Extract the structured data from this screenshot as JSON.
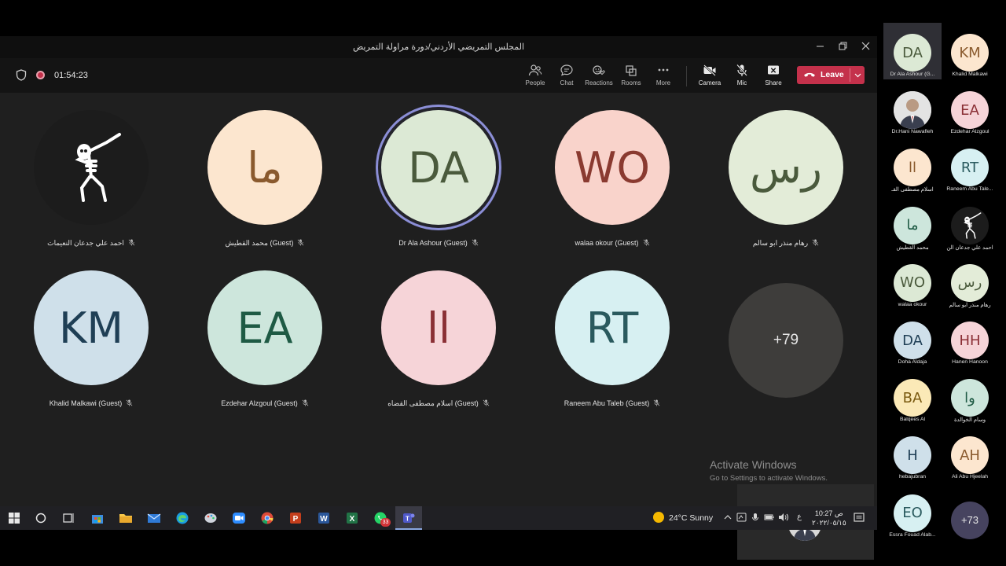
{
  "window": {
    "title": "المجلس التمريضي الأردني/دورة مراولة التمريض",
    "minimize_icon": "minimize-icon",
    "maximize_icon": "restore-icon",
    "close_icon": "close-icon"
  },
  "meeting": {
    "timer": "01:54:23",
    "toolbar": [
      {
        "id": "people",
        "label": "People",
        "icon": "people-icon"
      },
      {
        "id": "chat",
        "label": "Chat",
        "icon": "chat-icon"
      },
      {
        "id": "reactions",
        "label": "Reactions",
        "icon": "reactions-icon"
      },
      {
        "id": "rooms",
        "label": "Rooms",
        "icon": "rooms-icon"
      },
      {
        "id": "more",
        "label": "More",
        "icon": "more-icon"
      },
      {
        "id": "camera",
        "label": "Camera",
        "icon": "camera-off-icon"
      },
      {
        "id": "mic",
        "label": "Mic",
        "icon": "mic-off-icon"
      },
      {
        "id": "share",
        "label": "Share",
        "icon": "share-icon"
      }
    ],
    "leave_label": "Leave",
    "leave_color": "#c4314b"
  },
  "gallery": [
    {
      "initials": "",
      "name": "احمد علي جدعان النعيمات",
      "bg": "#1c1c1c",
      "fg": "#ffffff",
      "image": "dancing-skeleton"
    },
    {
      "initials": "ما",
      "name": "محمد القطيش (Guest)",
      "bg": "#fce6cf",
      "fg": "#8a5a2e"
    },
    {
      "initials": "DA",
      "name": "Dr Ala Ashour (Guest)",
      "bg": "#dce9d5",
      "fg": "#4a5a3c",
      "speaking": true
    },
    {
      "initials": "WO",
      "name": "walaa okour (Guest)",
      "bg": "#f9d3cb",
      "fg": "#8a3a30"
    },
    {
      "initials": "رس",
      "name": "رهام منذر ابو سالم",
      "bg": "#e3ecd8",
      "fg": "#4a5a3c"
    },
    {
      "initials": "KM",
      "name": "Khalid Malkawi (Guest)",
      "bg": "#cfe0ea",
      "fg": "#1f3f55"
    },
    {
      "initials": "EA",
      "name": "Ezdehar Alzgoul (Guest)",
      "bg": "#cde6dc",
      "fg": "#1e5a44"
    },
    {
      "initials": "اا",
      "name": "اسلام مصطفى القضاه (Guest)",
      "bg": "#f6d4d8",
      "fg": "#8a2f35"
    },
    {
      "initials": "RT",
      "name": "Raneem Abu Taleb (Guest)",
      "bg": "#d7f0f2",
      "fg": "#2a5a5e"
    }
  ],
  "overflow_count": "+79",
  "watermark": {
    "line1": "Activate Windows",
    "line2": "Go to Settings to activate Windows."
  },
  "sidebar": [
    {
      "initials": "DA",
      "name": "Dr Ala Ashour (G...",
      "bg": "#dce9d5",
      "fg": "#4a5a3c",
      "selected": true
    },
    {
      "initials": "KM",
      "name": "Khalid Malkawi",
      "bg": "#fce6cf",
      "fg": "#8a5a2e"
    },
    {
      "initials": "",
      "name": "Dr.Hani Nawafleh",
      "bg": "#e8e8e8",
      "fg": "#333333",
      "image": "photo"
    },
    {
      "initials": "EA",
      "name": "Ezdehar Alzgoul",
      "bg": "#f6d4d8",
      "fg": "#8a2f35"
    },
    {
      "initials": "اا",
      "name": "اسلام مصطفى القـ",
      "bg": "#fce6cf",
      "fg": "#8a5a2e"
    },
    {
      "initials": "RT",
      "name": "Raneem Abu Tale...",
      "bg": "#d7f0f2",
      "fg": "#2a5a5e"
    },
    {
      "initials": "ما",
      "name": "محمد القطيش",
      "bg": "#cde6dc",
      "fg": "#1e5a44"
    },
    {
      "initials": "",
      "name": "احمد علي جدعان الن",
      "bg": "#1c1c1c",
      "fg": "#ffffff",
      "image": "dancing-skeleton"
    },
    {
      "initials": "WO",
      "name": "walaa okour",
      "bg": "#dce9d5",
      "fg": "#4a5a3c"
    },
    {
      "initials": "رس",
      "name": "رهام منذر ابو سالم",
      "bg": "#e3ecd8",
      "fg": "#4a5a3c"
    },
    {
      "initials": "DA",
      "name": "Doha Aldaja",
      "bg": "#cfe0ea",
      "fg": "#1f3f55"
    },
    {
      "initials": "HH",
      "name": "Hanen Hanoon",
      "bg": "#f6d4d8",
      "fg": "#8a2f35"
    },
    {
      "initials": "BA",
      "name": "Balqees Al",
      "bg": "#fbe9b7",
      "fg": "#7a5a10"
    },
    {
      "initials": "وا",
      "name": "وسام الخوالدة",
      "bg": "#cde6dc",
      "fg": "#1e5a44"
    },
    {
      "initials": "H",
      "name": "hebajubran",
      "bg": "#cfe0ea",
      "fg": "#1f3f55"
    },
    {
      "initials": "AH",
      "name": "Ali Abu Hjeelah",
      "bg": "#fce6cf",
      "fg": "#8a5a2e"
    },
    {
      "initials": "EO",
      "name": "Essra Fouad Alab...",
      "bg": "#d7f0f2",
      "fg": "#2a5a5e"
    },
    {
      "initials": "+73",
      "name": "",
      "bg": "#46435f",
      "fg": "#e8e8e8",
      "more": true
    }
  ],
  "taskbar": {
    "apps": [
      "windows-start-icon",
      "search-icon",
      "task-view-icon",
      "store-icon",
      "file-explorer-icon",
      "mail-icon",
      "edge-icon",
      "paint-icon",
      "zoom-icon",
      "chrome-icon",
      "powerpoint-icon",
      "word-icon",
      "excel-icon",
      "whatsapp-icon",
      "teams-icon"
    ],
    "whatsapp_badge": "33",
    "weather": "24°C Sunny",
    "lang": "ع",
    "time": "10:27 ص",
    "date": "٢٠٢٢/٠٥/١٥"
  }
}
